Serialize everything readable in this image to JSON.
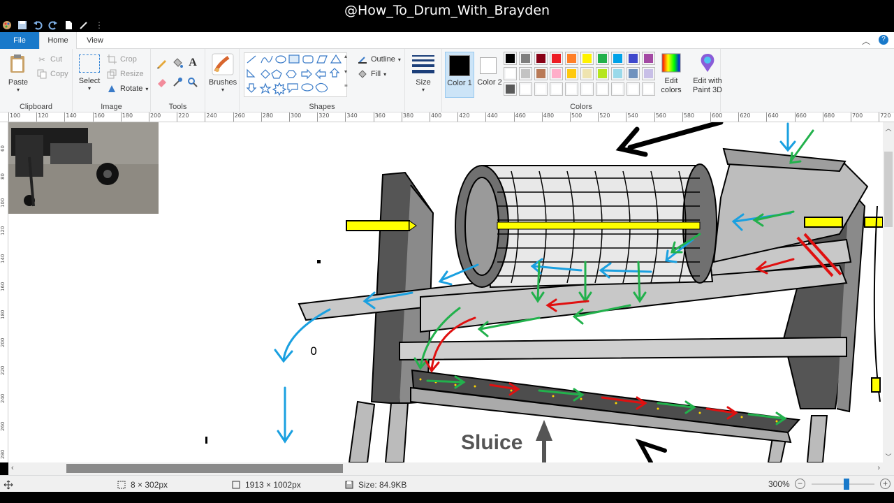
{
  "window": {
    "title": "@How_To_Drum_With_Brayden"
  },
  "tabs": {
    "file": "File",
    "home": "Home",
    "view": "View"
  },
  "ribbon": {
    "clipboard": {
      "label": "Clipboard",
      "paste": "Paste",
      "cut": "Cut",
      "copy": "Copy"
    },
    "image": {
      "label": "Image",
      "select": "Select",
      "crop": "Crop",
      "resize": "Resize",
      "rotate": "Rotate"
    },
    "tools": {
      "label": "Tools"
    },
    "brushes": {
      "label": "Brushes"
    },
    "shapes": {
      "label": "Shapes",
      "outline": "Outline",
      "fill": "Fill"
    },
    "size": {
      "label": "Size"
    },
    "colors": {
      "label": "Colors",
      "color1": "Color 1",
      "color2": "Color 2",
      "edit_colors": "Edit colors",
      "edit_paint3d": "Edit with Paint 3D",
      "color1_value": "#000000",
      "color2_value": "#ffffff",
      "palette_row1": [
        "#000000",
        "#7f7f7f",
        "#880015",
        "#ed1c24",
        "#ff7f27",
        "#fff200",
        "#22b14c",
        "#00a2e8",
        "#3f48cc",
        "#a349a4"
      ],
      "palette_row2": [
        "#ffffff",
        "#c3c3c3",
        "#b97a57",
        "#ffaec9",
        "#ffc90e",
        "#efe4b0",
        "#b5e61d",
        "#99d9ea",
        "#7092be",
        "#c8bfe7"
      ],
      "palette_row3": [
        "#5a5a5a",
        "#ffffff",
        "#ffffff",
        "#ffffff",
        "#ffffff",
        "#ffffff",
        "#ffffff",
        "#ffffff",
        "#ffffff",
        "#ffffff"
      ]
    }
  },
  "ruler": {
    "top_ticks": [
      "100",
      "120",
      "140",
      "160",
      "180",
      "200",
      "220",
      "240",
      "260",
      "280",
      "300",
      "320",
      "340",
      "360",
      "380",
      "400",
      "420",
      "440",
      "460",
      "480",
      "500",
      "520",
      "540",
      "560",
      "580",
      "600",
      "620",
      "640",
      "660",
      "680",
      "700",
      "720"
    ],
    "left_ticks": [
      "60",
      "80",
      "100",
      "120",
      "140",
      "160",
      "180",
      "200",
      "220",
      "240",
      "260",
      "280"
    ]
  },
  "canvas": {
    "label": "Sluice"
  },
  "status": {
    "selection": "8 × 302px",
    "image_size": "1913 × 1002px",
    "file_size": "Size: 84.9KB",
    "zoom": "300%",
    "zoom_level": 0.55
  }
}
